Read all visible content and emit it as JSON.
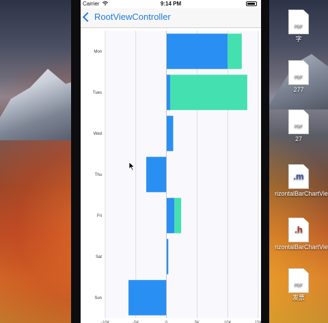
{
  "status": {
    "carrier": "Carrier",
    "time": "9:14 PM"
  },
  "nav": {
    "title": "RootViewController"
  },
  "desktop_icons": [
    {
      "ext": "",
      "tag": "PDF",
      "label": "字"
    },
    {
      "ext": "",
      "tag": "PDF",
      "label": "277"
    },
    {
      "ext": "",
      "tag": "PDF",
      "label": "27"
    },
    {
      "ext": ".m",
      "tag": "",
      "label": "rizontalBarChartView.m"
    },
    {
      "ext": ".h",
      "tag": "",
      "label": "rizontalBarChartView.h"
    },
    {
      "ext": "",
      "tag": "PDF",
      "label": "发票"
    }
  ],
  "chart_data": {
    "type": "bar",
    "orientation": "horizontal",
    "stacked": true,
    "categories": [
      "Mon",
      "Tues",
      "Wed",
      "Thu",
      "Fri",
      "Sat",
      "Sun"
    ],
    "series": [
      {
        "values": [
          10000,
          600,
          1100,
          -3300,
          1300,
          300,
          -6200
        ]
      },
      {
        "values": [
          2300,
          12600,
          0,
          0,
          1100,
          0,
          0
        ]
      }
    ],
    "xlim": [
      -10000,
      15000
    ],
    "xticks": [
      -10000,
      -5000,
      0,
      5000,
      10000,
      15000
    ],
    "xticklabels": [
      "-10K",
      "-5K",
      "0",
      "5K",
      "10K",
      "15K"
    ],
    "colors": [
      "#2a8ff2",
      "#45e0b0"
    ],
    "grid": true
  }
}
